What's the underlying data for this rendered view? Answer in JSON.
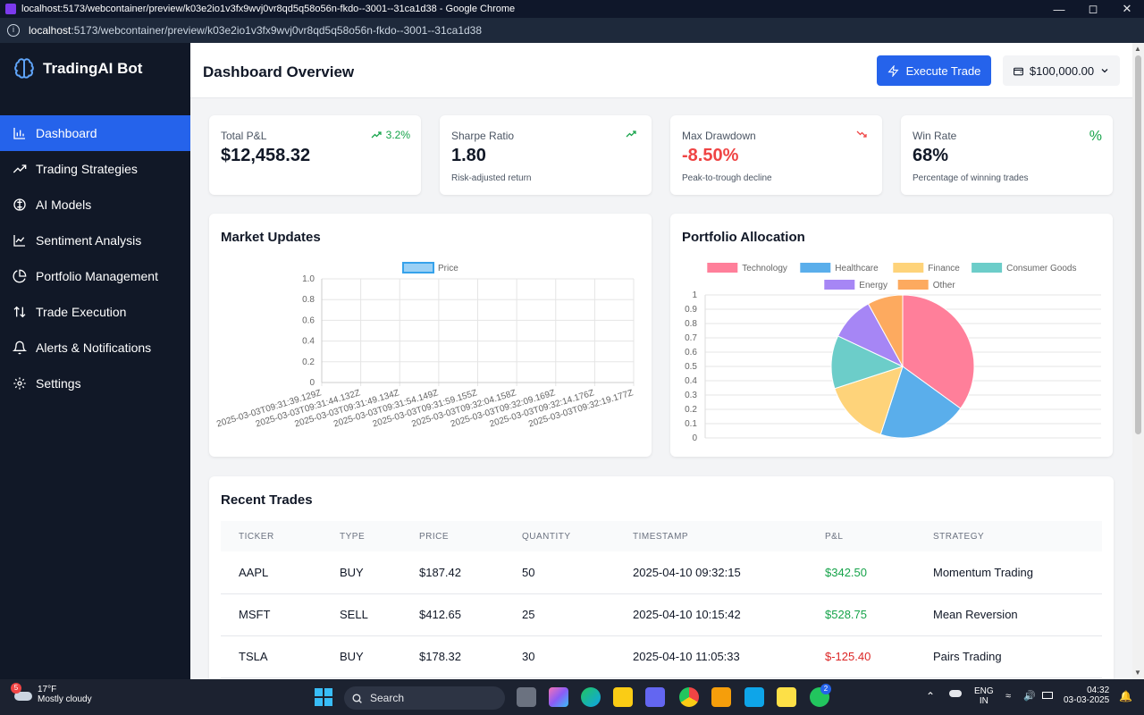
{
  "browser": {
    "window_title": "localhost:5173/webcontainer/preview/k03e2io1v3fx9wvj0vr8qd5q58o56n-fkdo--3001--31ca1d38 - Google Chrome",
    "url_host": "localhost",
    "url_rest": ":5173/webcontainer/preview/k03e2io1v3fx9wvj0vr8qd5q58o56n-fkdo--3001--31ca1d38"
  },
  "sidebar": {
    "brand": "TradingAI Bot",
    "items": [
      {
        "label": "Dashboard",
        "icon": "bar-chart-icon",
        "active": true
      },
      {
        "label": "Trading Strategies",
        "icon": "trending-up-icon"
      },
      {
        "label": "AI Models",
        "icon": "brain-icon"
      },
      {
        "label": "Sentiment Analysis",
        "icon": "line-chart-icon"
      },
      {
        "label": "Portfolio Management",
        "icon": "pie-chart-icon"
      },
      {
        "label": "Trade Execution",
        "icon": "arrows-up-down-icon"
      },
      {
        "label": "Alerts & Notifications",
        "icon": "bell-icon"
      },
      {
        "label": "Settings",
        "icon": "gear-icon"
      }
    ]
  },
  "header": {
    "title": "Dashboard Overview",
    "execute_label": "Execute Trade",
    "balance": "$100,000.00"
  },
  "stats": [
    {
      "label": "Total P&L",
      "value": "$12,458.32",
      "trend": "3.2%",
      "sub": ""
    },
    {
      "label": "Sharpe Ratio",
      "value": "1.80",
      "sub": "Risk-adjusted return"
    },
    {
      "label": "Max Drawdown",
      "value": "-8.50%",
      "sub": "Peak-to-trough decline"
    },
    {
      "label": "Win Rate",
      "value": "68%",
      "sub": "Percentage of winning trades",
      "icon_text": "%"
    }
  ],
  "market": {
    "title": "Market Updates",
    "legend": "Price",
    "y_ticks": [
      "1.0",
      "0.8",
      "0.6",
      "0.4",
      "0.2",
      "0"
    ],
    "x_labels": [
      "2025-03-03T09:31:39.129Z",
      "2025-03-03T09:31:44.132Z",
      "2025-03-03T09:31:49.134Z",
      "2025-03-03T09:31:54.149Z",
      "2025-03-03T09:31:59.155Z",
      "2025-03-03T09:32:04.158Z",
      "2025-03-03T09:32:09.169Z",
      "2025-03-03T09:32:14.176Z",
      "2025-03-03T09:32:19.177Z"
    ]
  },
  "portfolio": {
    "title": "Portfolio Allocation",
    "y_ticks": [
      "1",
      "0.9",
      "0.8",
      "0.7",
      "0.6",
      "0.5",
      "0.4",
      "0.3",
      "0.2",
      "0.1",
      "0"
    ],
    "slices": [
      {
        "name": "Technology",
        "value": 35,
        "color": "#ff7f9a"
      },
      {
        "name": "Healthcare",
        "value": 20,
        "color": "#5aaeeb"
      },
      {
        "name": "Finance",
        "value": 15,
        "color": "#fed37a"
      },
      {
        "name": "Consumer Goods",
        "value": 12,
        "color": "#6ccdc9"
      },
      {
        "name": "Energy",
        "value": 10,
        "color": "#a686f5"
      },
      {
        "name": "Other",
        "value": 8,
        "color": "#fdaa5f"
      }
    ]
  },
  "trades": {
    "title": "Recent Trades",
    "headers": [
      "TICKER",
      "TYPE",
      "PRICE",
      "QUANTITY",
      "TIMESTAMP",
      "P&L",
      "STRATEGY"
    ],
    "rows": [
      {
        "ticker": "AAPL",
        "type": "BUY",
        "price": "$187.42",
        "qty": "50",
        "ts": "2025-04-10 09:32:15",
        "pnl": "$342.50",
        "strategy": "Momentum Trading",
        "positive": true
      },
      {
        "ticker": "MSFT",
        "type": "SELL",
        "price": "$412.65",
        "qty": "25",
        "ts": "2025-04-10 10:15:42",
        "pnl": "$528.75",
        "strategy": "Mean Reversion",
        "positive": true
      },
      {
        "ticker": "TSLA",
        "type": "BUY",
        "price": "$178.32",
        "qty": "30",
        "ts": "2025-04-10 11:05:33",
        "pnl": "$-125.40",
        "strategy": "Pairs Trading",
        "positive": false
      }
    ]
  },
  "chart_data": [
    {
      "type": "line",
      "title": "",
      "series": [
        {
          "name": "Price",
          "values": []
        }
      ],
      "x": [
        "2025-03-03T09:31:39.129Z",
        "2025-03-03T09:31:44.132Z",
        "2025-03-03T09:31:49.134Z",
        "2025-03-03T09:31:54.149Z",
        "2025-03-03T09:31:59.155Z",
        "2025-03-03T09:32:04.158Z",
        "2025-03-03T09:32:09.169Z",
        "2025-03-03T09:32:14.176Z",
        "2025-03-03T09:32:19.177Z"
      ],
      "ylim": [
        0,
        1.0
      ],
      "grid": true,
      "legend": "top"
    },
    {
      "type": "pie",
      "categories": [
        "Technology",
        "Healthcare",
        "Finance",
        "Consumer Goods",
        "Energy",
        "Other"
      ],
      "values": [
        35,
        20,
        15,
        12,
        10,
        8
      ],
      "legend": "top",
      "grid": true
    }
  ],
  "taskbar": {
    "weather_temp": "17°F",
    "weather_desc": "Mostly cloudy",
    "weather_badge": "5",
    "search": "Search",
    "lang_top": "ENG",
    "lang_bottom": "IN",
    "time": "04:32",
    "date": "03-03-2025",
    "whatsapp_badge": "2"
  }
}
